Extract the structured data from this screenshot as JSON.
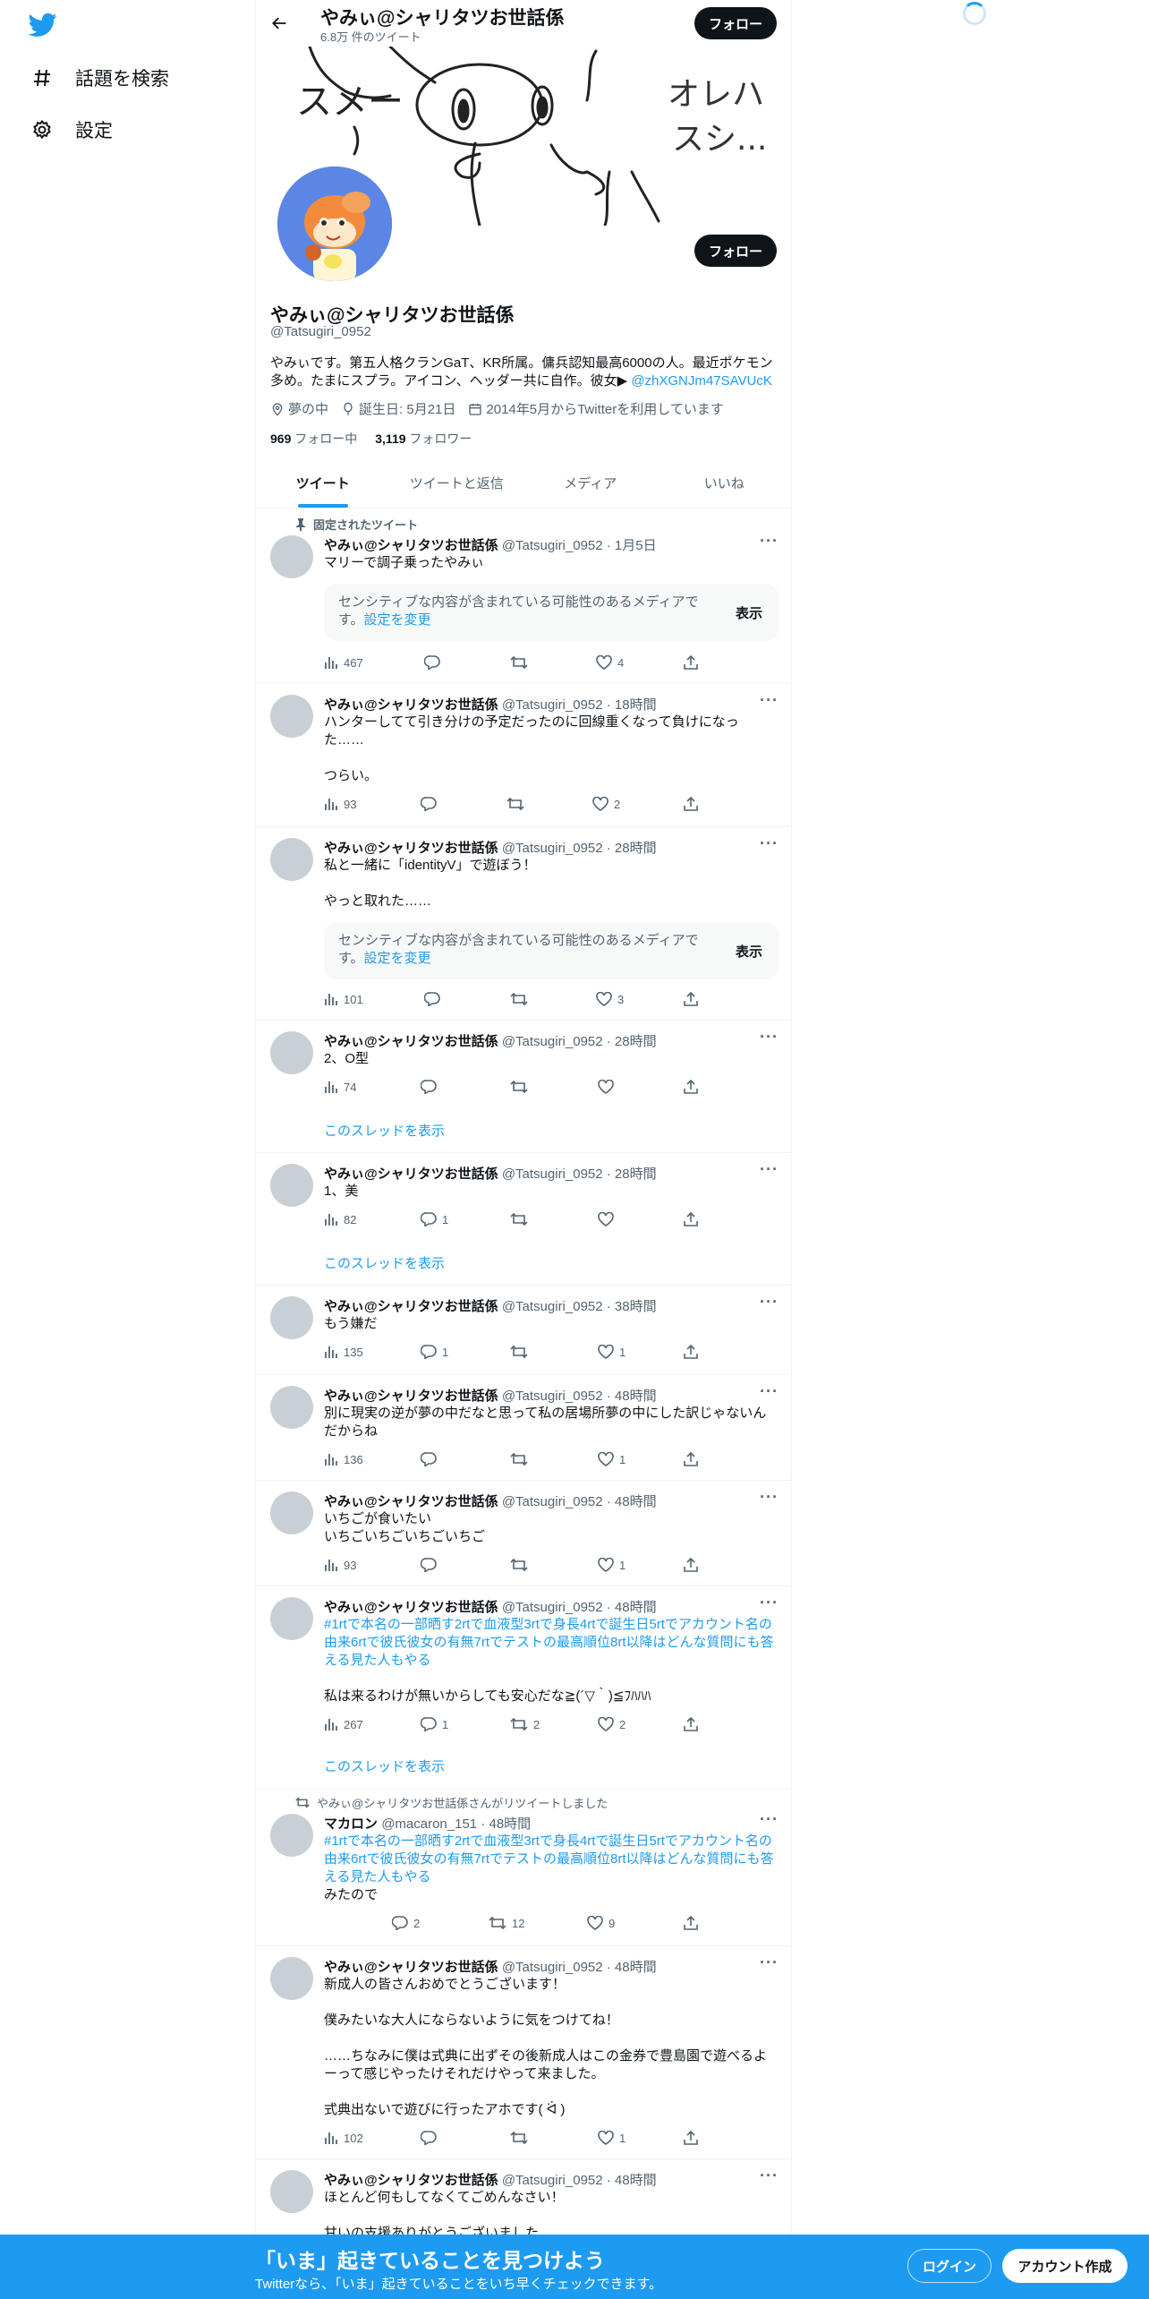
{
  "nav": {
    "explore_label": "話題を検索",
    "settings_label": "設定"
  },
  "header": {
    "name": "やみぃ@シャリタツお世話係",
    "tweet_count": "6.8万 件のツイート",
    "follow_label": "フォロー"
  },
  "profile": {
    "name": "やみぃ@シャリタツお世話係",
    "handle": "@Tatsugiri_0952",
    "follow_label": "フォロー",
    "bio": "やみぃです。第五人格クランGaT、KR所属。傭兵認知最高6000の人。最近ポケモン多め。たまにスプラ。アイコン、ヘッダー共に自作。彼女▶",
    "bio_link": "@zhXGNJm47SAVUcK",
    "location": "夢の中",
    "birthday": "誕生日: 5月21日",
    "joined": "2014年5月からTwitterを利用しています",
    "following_count": "969",
    "following_label": "フォロー中",
    "followers_count": "3,119",
    "followers_label": "フォロワー",
    "banner_text_left": "スメー",
    "banner_text_right_1": "オレハ",
    "banner_text_right_2": "スシ..."
  },
  "tabs": [
    "ツイート",
    "ツイートと返信",
    "メディア",
    "いいね"
  ],
  "pinned_label": "固定されたツイート",
  "sensitive": {
    "text": "センシティブな内容が含まれている可能性のあるメディアです。",
    "link": "設定を変更",
    "show": "表示"
  },
  "thread_label": "このスレッドを表示",
  "retweeted_label": "やみぃ@シャリタツお世話係さんがリツイートしました",
  "tweets": [
    {
      "name": "やみぃ@シャリタツお世話係",
      "handle": "@Tatsugiri_0952 · 1月5日",
      "text": "マリーで調子乗ったやみぃ",
      "views": "467",
      "replies": "",
      "rts": "",
      "likes": "4"
    },
    {
      "name": "やみぃ@シャリタツお世話係",
      "handle": "@Tatsugiri_0952 · 18時間",
      "text": "ハンターしてて引き分けの予定だったのに回線重くなって負けになった……\n\nつらい。",
      "views": "93",
      "replies": "",
      "rts": "",
      "likes": "2"
    },
    {
      "name": "やみぃ@シャリタツお世話係",
      "handle": "@Tatsugiri_0952 · 28時間",
      "text": "私と一緒に「identityV」で遊ぼう！\n\nやっと取れた……",
      "views": "101",
      "replies": "",
      "rts": "",
      "likes": "3"
    },
    {
      "name": "やみぃ@シャリタツお世話係",
      "handle": "@Tatsugiri_0952 · 28時間",
      "text": "2、O型",
      "views": "74",
      "replies": "",
      "rts": "",
      "likes": ""
    },
    {
      "name": "やみぃ@シャリタツお世話係",
      "handle": "@Tatsugiri_0952 · 28時間",
      "text": "1、美",
      "views": "82",
      "replies": "1",
      "rts": "",
      "likes": ""
    },
    {
      "name": "やみぃ@シャリタツお世話係",
      "handle": "@Tatsugiri_0952 · 38時間",
      "text": "もう嫌だ",
      "views": "135",
      "replies": "1",
      "rts": "",
      "likes": "1"
    },
    {
      "name": "やみぃ@シャリタツお世話係",
      "handle": "@Tatsugiri_0952 · 48時間",
      "text": "別に現実の逆が夢の中だなと思って私の居場所夢の中にした訳じゃないんだからね",
      "views": "136",
      "replies": "",
      "rts": "",
      "likes": "1"
    },
    {
      "name": "やみぃ@シャリタツお世話係",
      "handle": "@Tatsugiri_0952 · 48時間",
      "text": "いちごが食いたい\nいちごいちごいちごいちご",
      "views": "93",
      "replies": "",
      "rts": "",
      "likes": "1"
    },
    {
      "name": "やみぃ@シャリタツお世話係",
      "handle": "@Tatsugiri_0952 · 48時間",
      "text_link": "#1rtで本名の一部晒す2rtで血液型3rtで身長4rtで誕生日5rtでアカウント名の由来6rtで彼氏彼女の有無7rtでテストの最高順位8rt以降はどんな質問にも答える見た人もやる",
      "text": "私は来るわけが無いからしても安心だな≧(´▽｀)≦ﾌﾊﾊﾊ",
      "views": "267",
      "replies": "1",
      "rts": "2",
      "likes": "2"
    },
    {
      "name": "マカロン",
      "handle": "@macaron_151 · 48時間",
      "text_link": "#1rtで本名の一部晒す2rtで血液型3rtで身長4rtで誕生日5rtでアカウント名の由来6rtで彼氏彼女の有無7rtでテストの最高順位8rt以降はどんな質問にも答える見た人もやる",
      "text": "みたので",
      "views": "",
      "replies": "2",
      "rts": "12",
      "likes": "9"
    },
    {
      "name": "やみぃ@シャリタツお世話係",
      "handle": "@Tatsugiri_0952 · 48時間",
      "text": "新成人の皆さんおめでとうございます！\n\n僕みたいな大人にならないように気をつけてね！\n\n……ちなみに僕は式典に出ずその後新成人はこの金券で豊島園で遊べるよーって感じやったけそれだけやって来ました。\n\n式典出ないで遊びに行ったアホです( ᐛ )",
      "views": "102",
      "replies": "",
      "rts": "",
      "likes": "1"
    },
    {
      "name": "やみぃ@シャリタツお世話係",
      "handle": "@Tatsugiri_0952 · 48時間",
      "text": "ほとんど何もしてなくてごめんなさい！\n\n甘いの支援ありがとうございました",
      "views": "",
      "replies": "",
      "rts": "",
      "likes": ""
    }
  ],
  "bottom": {
    "title": "「いま」起きていることを見つけよう",
    "subtitle": "Twitterなら、「いま」起きていることをいち早くチェックできます。",
    "login": "ログイン",
    "signup": "アカウント作成"
  },
  "colors": {
    "accent": "#1d9bf0",
    "text": "#0f1419",
    "muted": "#536471",
    "border": "#eff3f4",
    "avatar_bg": "#5b86e5"
  }
}
